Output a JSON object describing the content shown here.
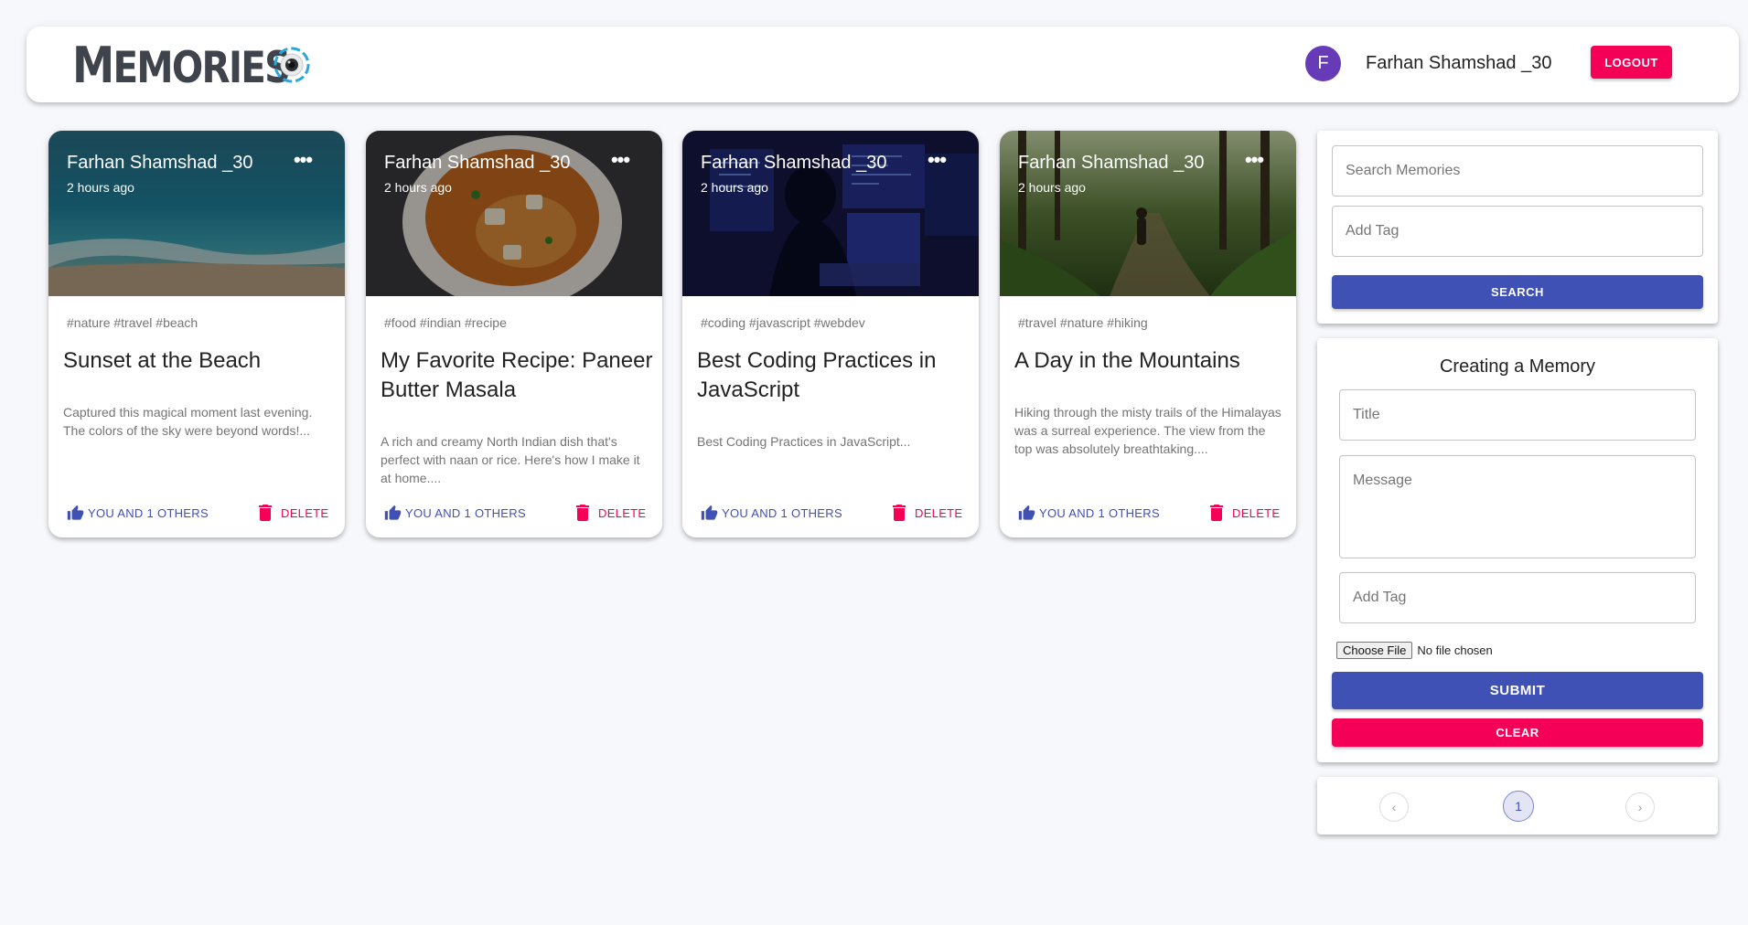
{
  "header": {
    "brand_initial": "M",
    "brand_rest": "EMORIES",
    "avatar_letter": "F",
    "username": "Farhan Shamshad _30",
    "logout_label": "LOGOUT",
    "colors": {
      "avatar": "#673ab7",
      "logout": "#f50057"
    }
  },
  "posts": [
    {
      "author": "Farhan Shamshad _30",
      "time": "2 hours ago",
      "tags": "#nature #travel #beach",
      "title": "Sunset at the Beach",
      "message": "Captured this magical moment last evening. The colors of the sky were beyond words!...",
      "like_label": "YOU AND 1 OTHERS",
      "delete_label": "DELETE",
      "more_label": "•••"
    },
    {
      "author": "Farhan Shamshad _30",
      "time": "2 hours ago",
      "tags": "#food #indian #recipe",
      "title": "My Favorite Recipe: Paneer Butter Masala",
      "message": "A rich and creamy North Indian dish that's perfect with naan or rice. Here's how I make it at home....",
      "like_label": "YOU AND 1 OTHERS",
      "delete_label": "DELETE",
      "more_label": "•••"
    },
    {
      "author": "Farhan Shamshad _30",
      "time": "2 hours ago",
      "tags": "#coding #javascript #webdev",
      "title": "Best Coding Practices in JavaScript",
      "message": "Best Coding Practices in JavaScript...",
      "like_label": "YOU AND 1 OTHERS",
      "delete_label": "DELETE",
      "more_label": "•••"
    },
    {
      "author": "Farhan Shamshad _30",
      "time": "2 hours ago",
      "tags": "#travel #nature #hiking",
      "title": "A Day in the Mountains",
      "message": "Hiking through the misty trails of the Himalayas was a surreal experience. The view from the top was absolutely breathtaking....",
      "like_label": "YOU AND 1 OTHERS",
      "delete_label": "DELETE",
      "more_label": "•••"
    }
  ],
  "search": {
    "search_placeholder": "Search Memories",
    "tag_placeholder": "Add Tag",
    "button_label": "SEARCH"
  },
  "form": {
    "title": "Creating a Memory",
    "title_placeholder": "Title",
    "message_placeholder": "Message",
    "tags_placeholder": "Add Tag",
    "file_button": "Choose File",
    "file_status": "No file chosen",
    "submit_label": "SUBMIT",
    "clear_label": "CLEAR"
  },
  "pagination": {
    "prev": "‹",
    "current_page": "1",
    "next": "›"
  },
  "colors": {
    "primary": "#3f51b5",
    "secondary": "#f50057",
    "background": "#f7f8fc"
  }
}
